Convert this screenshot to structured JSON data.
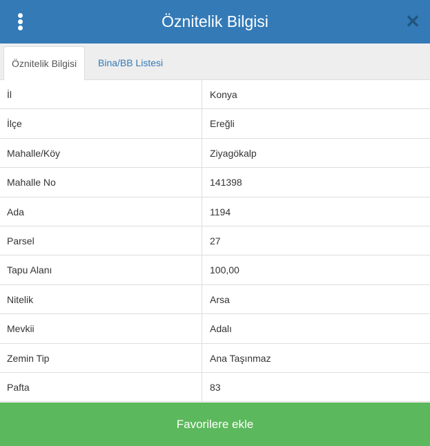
{
  "header": {
    "title": "Öznitelik Bilgisi",
    "menu_icon": "vertical-ellipsis-icon",
    "close_icon": "close-icon",
    "close_glyph": "✕",
    "color": "#337ab7"
  },
  "tabs": [
    {
      "label": "Öznitelik Bilgisi",
      "active": true
    },
    {
      "label": "Bina/BB Listesi",
      "active": false
    }
  ],
  "rows": [
    {
      "key": "İl",
      "value": "Konya"
    },
    {
      "key": "İlçe",
      "value": "Ereğli"
    },
    {
      "key": "Mahalle/Köy",
      "value": "Ziyagökalp"
    },
    {
      "key": "Mahalle No",
      "value": "141398"
    },
    {
      "key": "Ada",
      "value": "1194"
    },
    {
      "key": "Parsel",
      "value": "27"
    },
    {
      "key": "Tapu Alanı",
      "value": "100,00"
    },
    {
      "key": "Nitelik",
      "value": "Arsa"
    },
    {
      "key": "Mevkii",
      "value": "Adalı"
    },
    {
      "key": "Zemin Tip",
      "value": "Ana Taşınmaz"
    },
    {
      "key": "Pafta",
      "value": "83"
    }
  ],
  "footer": {
    "button_label": "Favorilere ekle",
    "color": "#5cb85c"
  }
}
